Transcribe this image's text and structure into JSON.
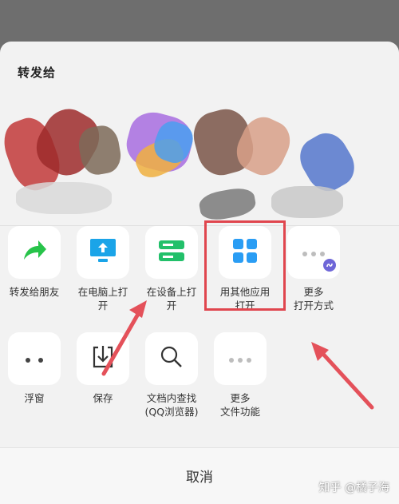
{
  "share_sheet": {
    "title": "转发给"
  },
  "actions_row1": [
    {
      "label": "转发给朋友",
      "icon": "share-arrow-icon"
    },
    {
      "label": "在电脑上打\n开",
      "icon": "monitor-upload-icon"
    },
    {
      "label": "在设备上打\n开",
      "icon": "device-stack-icon"
    },
    {
      "label": "用其他应用\n打开",
      "icon": "app-grid-icon"
    },
    {
      "label": "更多\n打开方式",
      "icon": "more-dots-icon"
    }
  ],
  "actions_row2": [
    {
      "label": "浮窗",
      "icon": "floating-window-icon"
    },
    {
      "label": "保存",
      "icon": "download-save-icon"
    },
    {
      "label": "文档内查找\n(QQ浏览器)",
      "icon": "search-icon"
    },
    {
      "label": "更多\n文件功能",
      "icon": "more-dots-icon"
    }
  ],
  "cancel_label": "取消",
  "watermark": "知乎 @橘子海",
  "colors": {
    "share_green": "#27c34a",
    "monitor_blue": "#1aa4e8",
    "device_green": "#22c06a",
    "apps_blue": "#2a9df4",
    "highlight_red": "#e0464e",
    "arrow_red": "#e4515a"
  }
}
